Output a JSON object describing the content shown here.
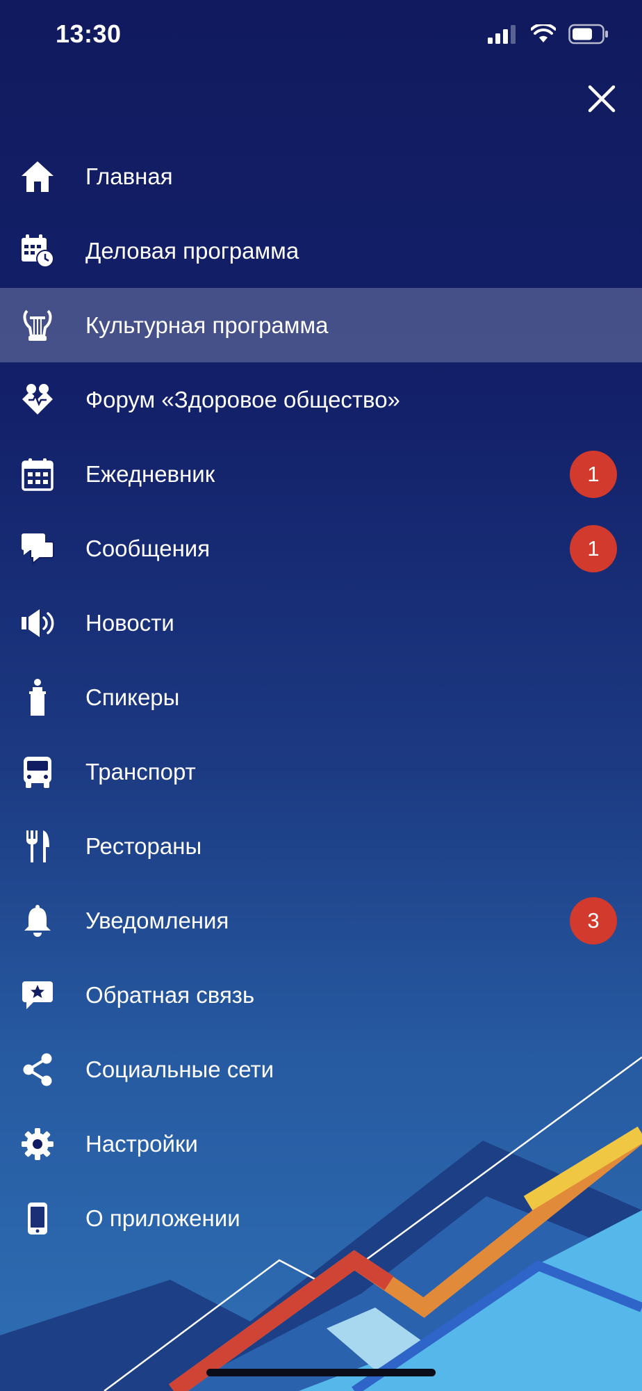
{
  "status_bar": {
    "time": "13:30"
  },
  "menu": {
    "items": [
      {
        "label": "Главная",
        "icon": "home-icon"
      },
      {
        "label": "Деловая программа",
        "icon": "calendar-clock-icon"
      },
      {
        "label": "Культурная программа",
        "icon": "lyre-icon",
        "active": true
      },
      {
        "label": "Форум «Здоровое общество»",
        "icon": "health-heart-icon"
      },
      {
        "label": "Ежедневник",
        "icon": "calendar-grid-icon",
        "badge": "1"
      },
      {
        "label": "Сообщения",
        "icon": "chat-bubbles-icon",
        "badge": "1"
      },
      {
        "label": "Новости",
        "icon": "megaphone-icon"
      },
      {
        "label": "Спикеры",
        "icon": "speaker-podium-icon"
      },
      {
        "label": "Транспорт",
        "icon": "bus-icon"
      },
      {
        "label": "Рестораны",
        "icon": "fork-knife-icon"
      },
      {
        "label": "Уведомления",
        "icon": "bell-icon",
        "badge": "3"
      },
      {
        "label": "Обратная связь",
        "icon": "feedback-star-icon"
      },
      {
        "label": "Социальные сети",
        "icon": "share-icon"
      },
      {
        "label": "Настройки",
        "icon": "gear-icon"
      },
      {
        "label": "О приложении",
        "icon": "phone-icon"
      }
    ]
  },
  "colors": {
    "background_top": "#111a5e",
    "background_bottom": "#2f6fb4",
    "active_row": "#474f86",
    "badge": "#d13a2c"
  }
}
